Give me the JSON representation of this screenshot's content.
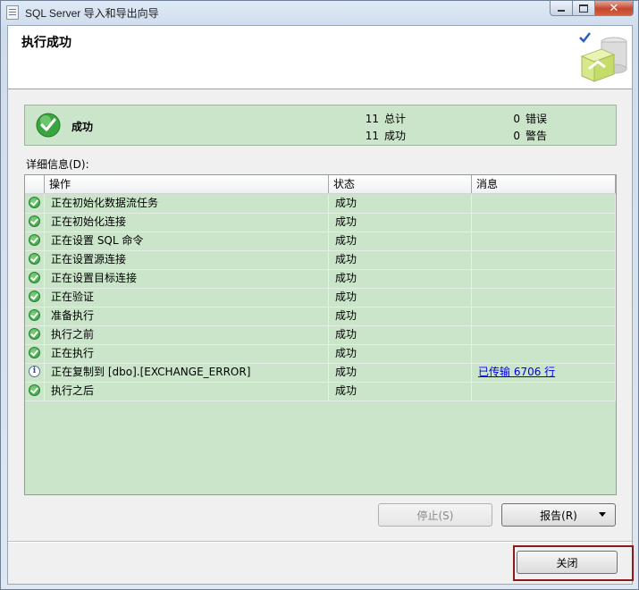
{
  "window": {
    "title": "SQL Server 导入和导出向导",
    "close_glyph": "✕"
  },
  "header": {
    "page_title": "执行成功"
  },
  "summary": {
    "status": "成功",
    "total_count": "11",
    "total_label": "总计",
    "success_count": "11",
    "success_label": "成功",
    "error_count": "0",
    "error_label": "错误",
    "warning_count": "0",
    "warning_label": "警告"
  },
  "details": {
    "label": "详细信息(D):",
    "columns": {
      "operation": "操作",
      "status": "状态",
      "message": "消息"
    },
    "rows": [
      {
        "icon": "success-icon",
        "operation": "正在初始化数据流任务",
        "status": "成功",
        "message": ""
      },
      {
        "icon": "success-icon",
        "operation": "正在初始化连接",
        "status": "成功",
        "message": ""
      },
      {
        "icon": "success-icon",
        "operation": "正在设置 SQL 命令",
        "status": "成功",
        "message": ""
      },
      {
        "icon": "success-icon",
        "operation": "正在设置源连接",
        "status": "成功",
        "message": ""
      },
      {
        "icon": "success-icon",
        "operation": "正在设置目标连接",
        "status": "成功",
        "message": ""
      },
      {
        "icon": "success-icon",
        "operation": "正在验证",
        "status": "成功",
        "message": ""
      },
      {
        "icon": "success-icon",
        "operation": "准备执行",
        "status": "成功",
        "message": ""
      },
      {
        "icon": "success-icon",
        "operation": "执行之前",
        "status": "成功",
        "message": ""
      },
      {
        "icon": "success-icon",
        "operation": "正在执行",
        "status": "成功",
        "message": ""
      },
      {
        "icon": "info-icon",
        "operation": "正在复制到 [dbo].[EXCHANGE_ERROR]",
        "status": "成功",
        "message": "已传输 6706 行"
      },
      {
        "icon": "success-icon",
        "operation": "执行之后",
        "status": "成功",
        "message": ""
      }
    ]
  },
  "buttons": {
    "stop": "停止(S)",
    "report": "报告(R)",
    "close": "关闭"
  },
  "colors": {
    "panel_green": "#cbe5cb",
    "link_blue": "#0000ee",
    "highlight_red": "#8b1a1a"
  }
}
